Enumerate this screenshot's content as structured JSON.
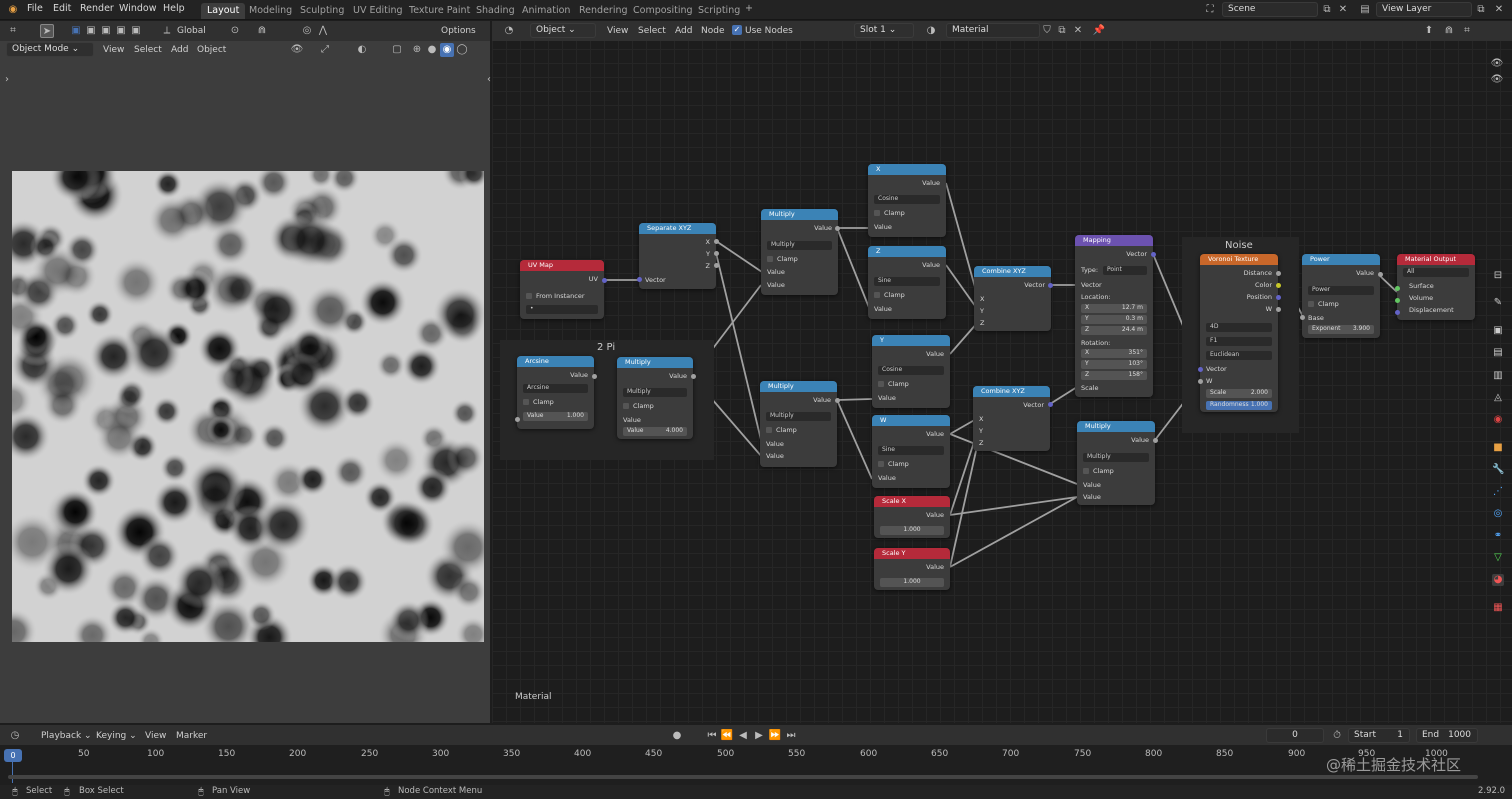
{
  "menu": {
    "file": "File",
    "edit": "Edit",
    "render": "Render",
    "window": "Window",
    "help": "Help"
  },
  "workspaces": [
    "Layout",
    "Modeling",
    "Sculpting",
    "UV Editing",
    "Texture Paint",
    "Shading",
    "Animation",
    "Rendering",
    "Compositing",
    "Scripting"
  ],
  "add_workspace": "+",
  "scene": {
    "label": "Scene"
  },
  "view_layer": {
    "label": "View Layer"
  },
  "viewport": {
    "mode": "Object Mode",
    "view": "View",
    "select": "Select",
    "add": "Add",
    "object": "Object",
    "transform": "Global",
    "options": "Options"
  },
  "node_editor": {
    "type": "Object",
    "view": "View",
    "select": "Select",
    "add": "Add",
    "node": "Node",
    "use_nodes": "Use Nodes",
    "slot": "Slot 1",
    "material": "Material",
    "footer_label": "Material"
  },
  "frames": {
    "two_pi": "2 Pi",
    "noise": "Noise"
  },
  "nodes": {
    "uvmap": {
      "title": "UV Map",
      "uv": "UV",
      "from_instancer": "From Instancer",
      "field": "•"
    },
    "arcsine": {
      "title": "Arcsine",
      "value_out": "Value",
      "op": "Arcsine",
      "clamp": "Clamp",
      "value_label": "Value",
      "value": "1.000"
    },
    "mult1": {
      "title": "Multiply",
      "value_out": "Value",
      "op": "Multiply",
      "clamp": "Clamp",
      "value_in": "Value",
      "value_label": "Value",
      "value": "4.000"
    },
    "sepxyz": {
      "title": "Separate XYZ",
      "x": "X",
      "y": "Y",
      "z": "Z",
      "vector": "Vector"
    },
    "mult2": {
      "title": "Multiply",
      "value_out": "Value",
      "op": "Multiply",
      "clamp": "Clamp",
      "v1": "Value",
      "v2": "Value"
    },
    "mult3": {
      "title": "Multiply",
      "value_out": "Value",
      "op": "Multiply",
      "clamp": "Clamp",
      "v1": "Value",
      "v2": "Value"
    },
    "x": {
      "title": "X",
      "value_out": "Value",
      "op": "Cosine",
      "clamp": "Clamp",
      "value_in": "Value"
    },
    "z": {
      "title": "Z",
      "value_out": "Value",
      "op": "Sine",
      "clamp": "Clamp",
      "value_in": "Value"
    },
    "y": {
      "title": "Y",
      "value_out": "Value",
      "op": "Cosine",
      "clamp": "Clamp",
      "value_in": "Value"
    },
    "w": {
      "title": "W",
      "value_out": "Value",
      "op": "Sine",
      "clamp": "Clamp",
      "value_in": "Value"
    },
    "scalex": {
      "title": "Scale X",
      "value_out": "Value",
      "value": "1.000"
    },
    "scaley": {
      "title": "Scale Y",
      "value_out": "Value",
      "value": "1.000"
    },
    "comb1": {
      "title": "Combine XYZ",
      "vector": "Vector",
      "x": "X",
      "y": "Y",
      "z": "Z"
    },
    "comb2": {
      "title": "Combine XYZ",
      "vector": "Vector",
      "x": "X",
      "y": "Y",
      "z": "Z"
    },
    "mapping": {
      "title": "Mapping",
      "vector_out": "Vector",
      "type_label": "Type:",
      "type": "Point",
      "vector_in": "Vector",
      "location": "Location:",
      "lx_label": "X",
      "lx": "12.7 m",
      "ly_label": "Y",
      "ly": "0.3 m",
      "lz_label": "Z",
      "lz": "24.4 m",
      "rotation": "Rotation:",
      "rx_label": "X",
      "rx": "351°",
      "ry_label": "Y",
      "ry": "103°",
      "rz_label": "Z",
      "rz": "158°",
      "scale": "Scale"
    },
    "mult4": {
      "title": "Multiply",
      "value_out": "Value",
      "op": "Multiply",
      "clamp": "Clamp",
      "v1": "Value",
      "v2": "Value"
    },
    "voronoi": {
      "title": "Voronoi Texture",
      "distance": "Distance",
      "color": "Color",
      "position": "Position",
      "w": "W",
      "dim": "4D",
      "feature": "F1",
      "metric": "Euclidean",
      "vector": "Vector",
      "w_in": "W",
      "scale_label": "Scale",
      "scale": "2.000",
      "random_label": "Randomness",
      "random": "1.000"
    },
    "power": {
      "title": "Power",
      "value_out": "Value",
      "op": "Power",
      "clamp": "Clamp",
      "base": "Base",
      "exp_label": "Exponent",
      "exp": "3.900"
    },
    "output": {
      "title": "Material Output",
      "target": "All",
      "surface": "Surface",
      "volume": "Volume",
      "displacement": "Displacement"
    }
  },
  "timeline": {
    "playback": "Playback",
    "keying": "Keying",
    "view": "View",
    "marker": "Marker",
    "current_frame": "0",
    "start_label": "Start",
    "start": "1",
    "end_label": "End",
    "end": "1000",
    "cursor": "0",
    "ticks": [
      "50",
      "100",
      "150",
      "200",
      "250",
      "300",
      "350",
      "400",
      "450",
      "500",
      "550",
      "600",
      "650",
      "700",
      "750",
      "800",
      "850",
      "900",
      "950",
      "1000"
    ]
  },
  "status": {
    "select": "Select",
    "box_select": "Box Select",
    "pan_view": "Pan View",
    "node_context": "Node Context Menu",
    "version": "2.92.0"
  },
  "watermark": "@稀土掘金技术社区",
  "colors": {
    "bg": "#1d1d1d",
    "header_blue": "#3b83b6",
    "header_red": "#b52a3a",
    "header_purple": "#6c52b0",
    "header_orange": "#c8672a",
    "accent": "#4772b3"
  }
}
